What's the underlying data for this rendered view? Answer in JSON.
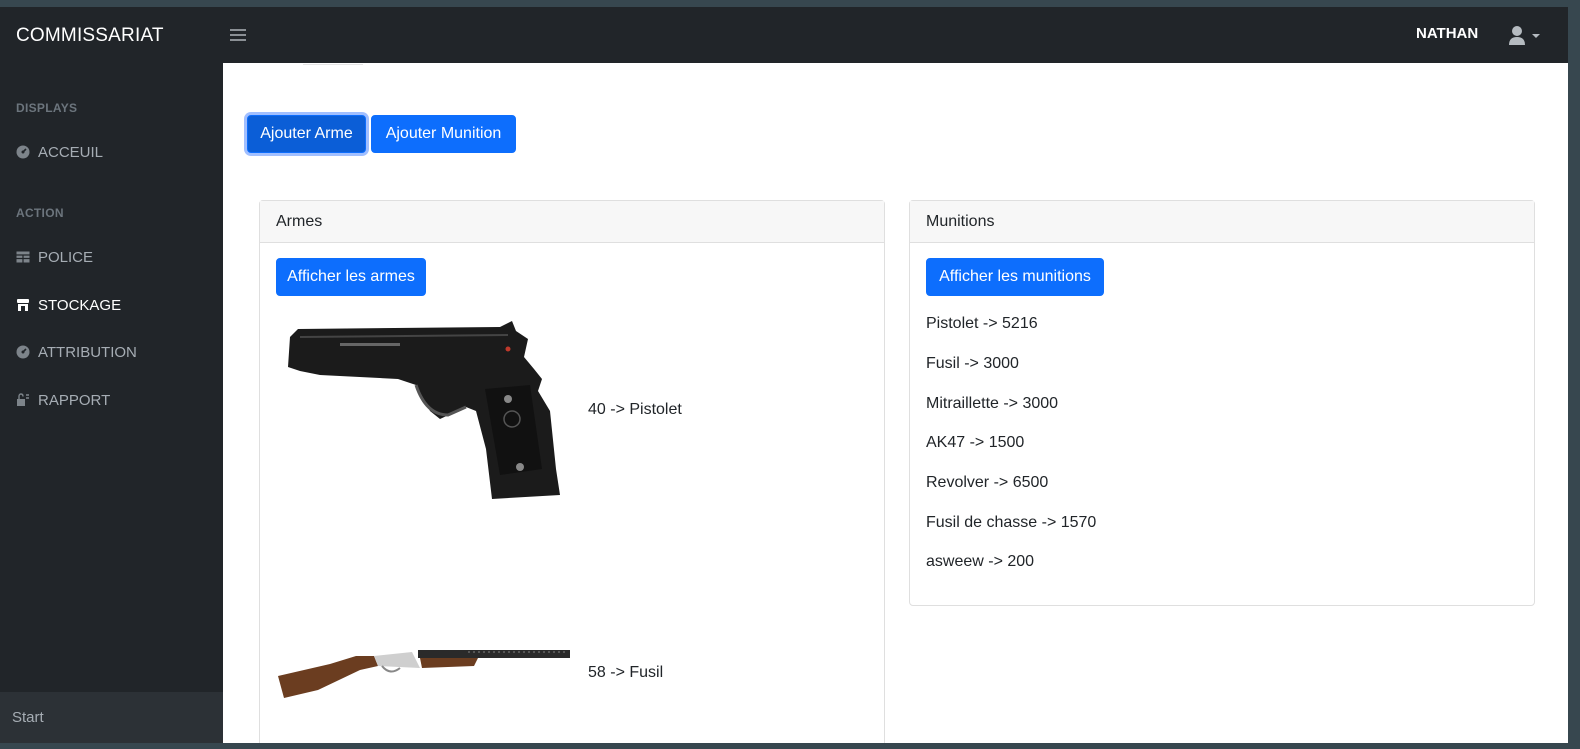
{
  "navbar": {
    "brand": "COMMISSARIAT",
    "user_name": "NATHAN"
  },
  "sidebar": {
    "sections": [
      {
        "heading": "DISPLAYS"
      },
      {
        "heading": "ACTION"
      }
    ],
    "items": [
      {
        "label": "ACCEUIL",
        "icon": "dashboard-icon"
      },
      {
        "label": "POLICE",
        "icon": "table-icon"
      },
      {
        "label": "STOCKAGE",
        "icon": "store-icon"
      },
      {
        "label": "ATTRIBUTION",
        "icon": "dashboard-icon"
      },
      {
        "label": "RAPPORT",
        "icon": "lock-icon"
      }
    ],
    "footer": "Start"
  },
  "actions": {
    "add_weapon": "Ajouter Arme",
    "add_ammo": "Ajouter Munition"
  },
  "weapons_card": {
    "title": "Armes",
    "button": "Afficher les armes",
    "items": [
      {
        "label": "40 -> Pistolet",
        "image": "pistol-image"
      },
      {
        "label": "58 -> Fusil",
        "image": "shotgun-image"
      }
    ]
  },
  "ammo_card": {
    "title": "Munitions",
    "button": "Afficher les munitions",
    "items": [
      "Pistolet -> 5216",
      "Fusil -> 3000",
      "Mitraillette -> 3000",
      "AK47 -> 1500",
      "Revolver -> 6500",
      "Fusil de chasse -> 1570",
      "asweew -> 200"
    ]
  },
  "colors": {
    "navbar": "#212529",
    "primary": "#0d6efd"
  }
}
